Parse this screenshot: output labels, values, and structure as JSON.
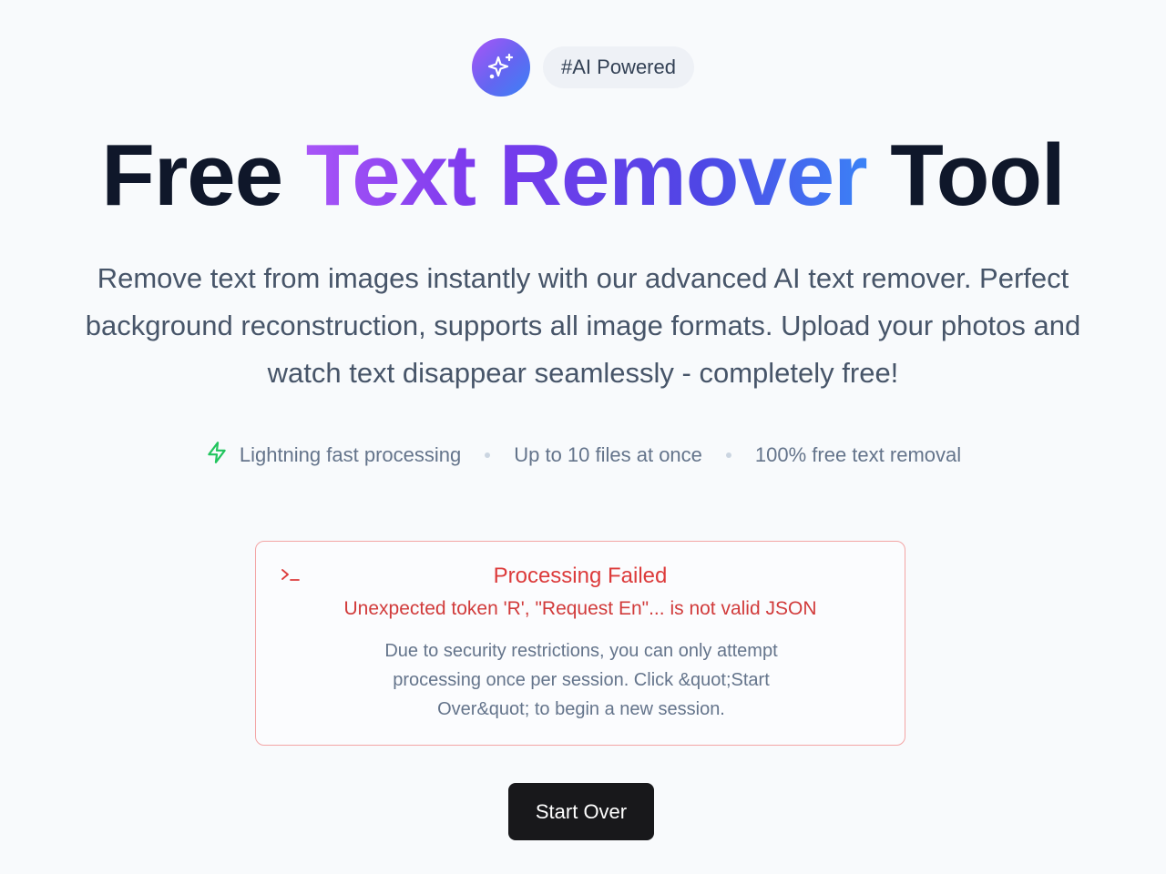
{
  "badge": {
    "icon": "sparkles-icon",
    "tag": "#AI Powered"
  },
  "hero": {
    "title_start": "Free",
    "title_highlight": "Text Remover",
    "title_end": "Tool",
    "subtitle": "Remove text from images instantly with our advanced AI text remover. Perfect background reconstruction, supports all image formats. Upload your photos and watch text disappear seamlessly - completely free!"
  },
  "features": [
    {
      "icon": "lightning-icon",
      "label": "Lightning fast processing"
    },
    {
      "label": "Up to 10 files at once"
    },
    {
      "label": "100% free text removal"
    }
  ],
  "error": {
    "icon": "terminal-icon",
    "title": "Processing Failed",
    "message": "Unexpected token 'R', \"Request En\"... is not valid JSON",
    "note": "Due to security restrictions, you can only attempt processing once per session. Click &quot;Start Over&quot; to begin a new session."
  },
  "actions": {
    "start_over_label": "Start Over"
  },
  "colors": {
    "background": "#f8fafc",
    "error_red": "#dc3b3b",
    "button_dark": "#18181b",
    "gradient_start": "#a855f7",
    "gradient_end": "#3b82f6",
    "lightning_green": "#22c55e"
  }
}
